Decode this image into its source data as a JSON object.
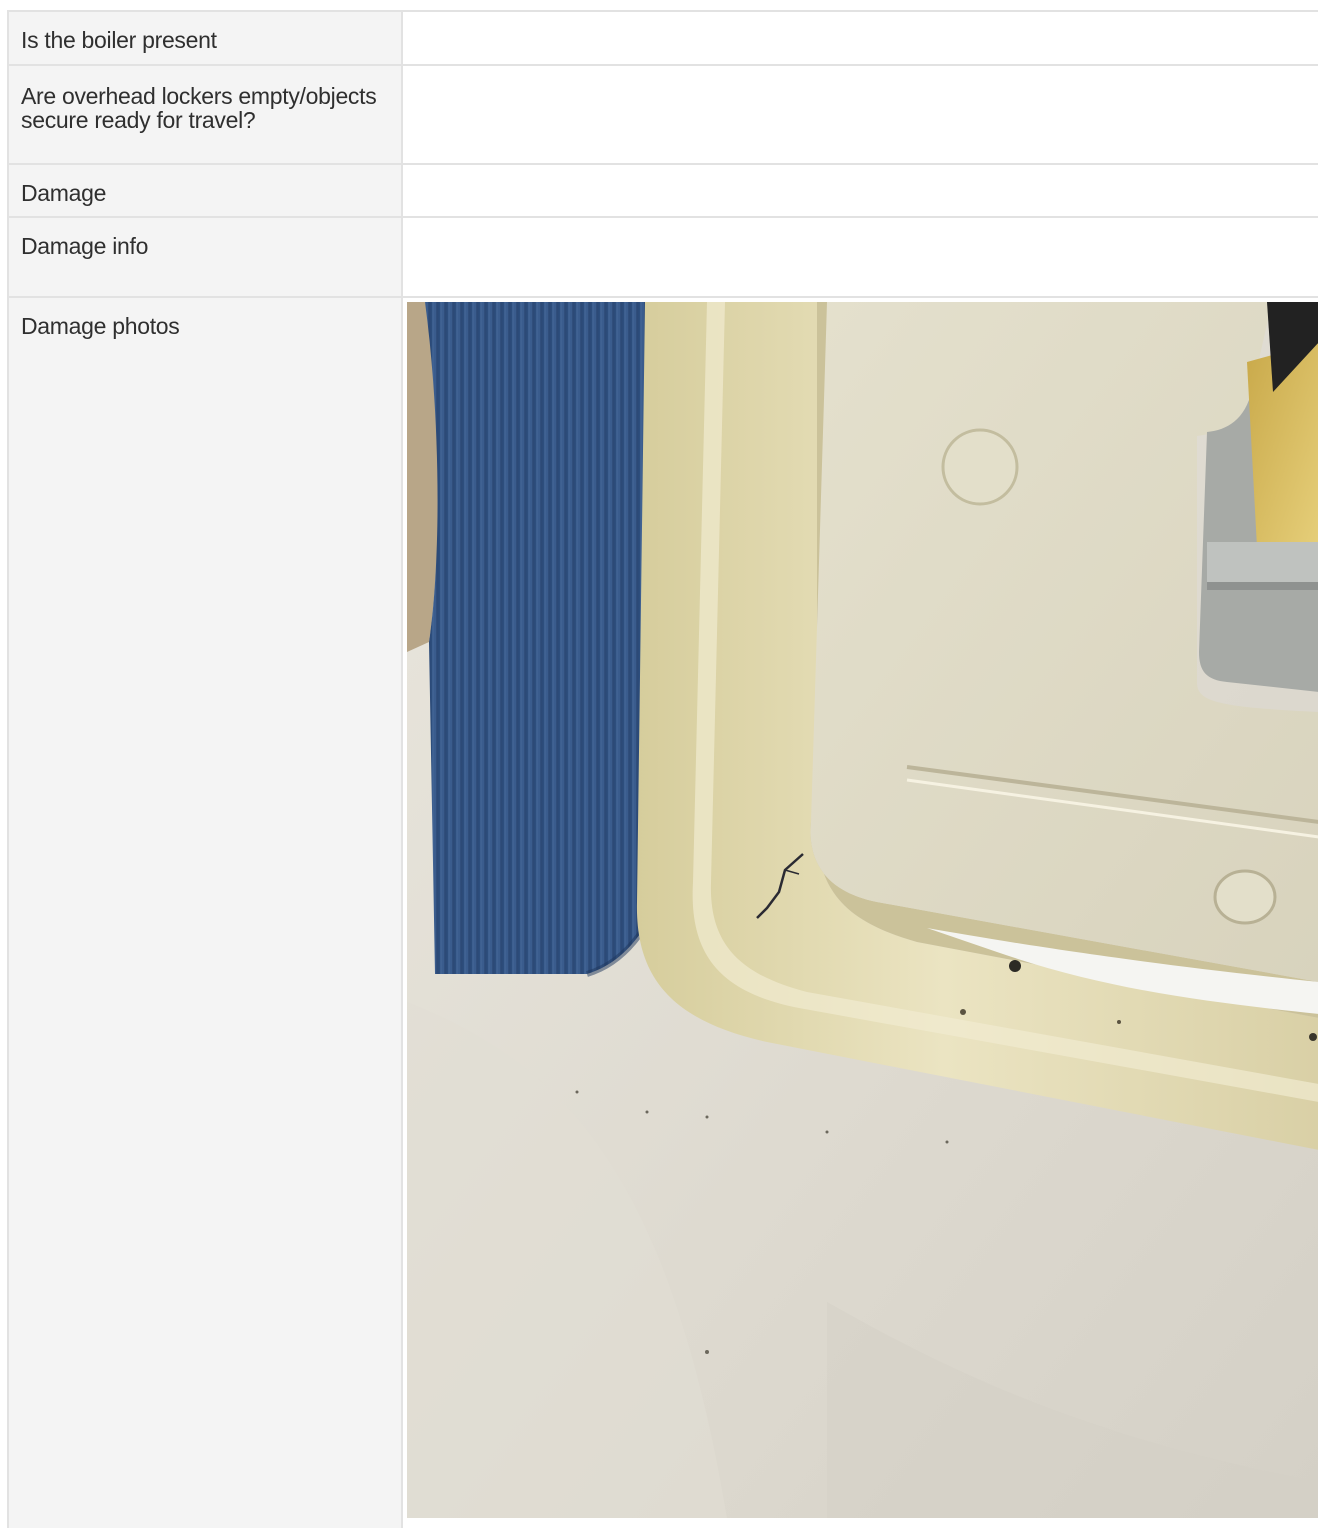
{
  "inspection_rows": [
    {
      "label": "Is the boiler present",
      "value": ""
    },
    {
      "label": "Are overhead lockers empty/objects secure ready for travel?",
      "value": ""
    },
    {
      "label": "Damage",
      "value": ""
    },
    {
      "label": "Damage info",
      "value": ""
    },
    {
      "label": "Damage photos",
      "value": ""
    }
  ],
  "photo": {
    "subject": "damage-photo"
  }
}
